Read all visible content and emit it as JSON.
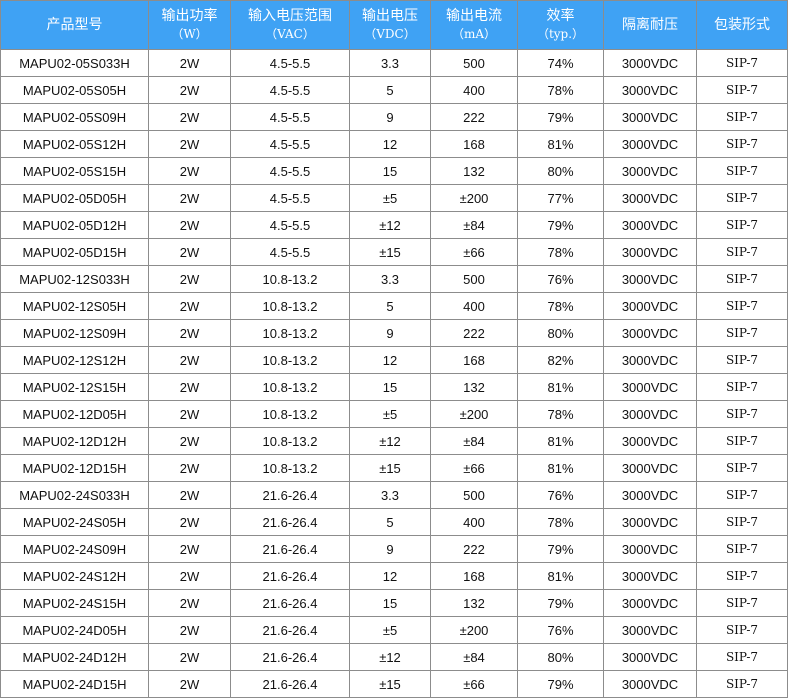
{
  "header": [
    {
      "label": "产品型号",
      "unit": ""
    },
    {
      "label": "输出功率",
      "unit": "（W）"
    },
    {
      "label": "输入电压范围",
      "unit": "（VAC）"
    },
    {
      "label": "输出电压",
      "unit": "（VDC）"
    },
    {
      "label": "输出电流",
      "unit": "（mA）"
    },
    {
      "label": "效率",
      "unit": "（typ.）"
    },
    {
      "label": "隔离耐压",
      "unit": ""
    },
    {
      "label": "包装形式",
      "unit": ""
    }
  ],
  "rows": [
    [
      "MAPU02-05S033H",
      "2W",
      "4.5-5.5",
      "3.3",
      "500",
      "74%",
      "3000VDC",
      "SIP-7"
    ],
    [
      "MAPU02-05S05H",
      "2W",
      "4.5-5.5",
      "5",
      "400",
      "78%",
      "3000VDC",
      "SIP-7"
    ],
    [
      "MAPU02-05S09H",
      "2W",
      "4.5-5.5",
      "9",
      "222",
      "79%",
      "3000VDC",
      "SIP-7"
    ],
    [
      "MAPU02-05S12H",
      "2W",
      "4.5-5.5",
      "12",
      "168",
      "81%",
      "3000VDC",
      "SIP-7"
    ],
    [
      "MAPU02-05S15H",
      "2W",
      "4.5-5.5",
      "15",
      "132",
      "80%",
      "3000VDC",
      "SIP-7"
    ],
    [
      "MAPU02-05D05H",
      "2W",
      "4.5-5.5",
      "±5",
      "±200",
      "77%",
      "3000VDC",
      "SIP-7"
    ],
    [
      "MAPU02-05D12H",
      "2W",
      "4.5-5.5",
      "±12",
      "±84",
      "79%",
      "3000VDC",
      "SIP-7"
    ],
    [
      "MAPU02-05D15H",
      "2W",
      "4.5-5.5",
      "±15",
      "±66",
      "78%",
      "3000VDC",
      "SIP-7"
    ],
    [
      "MAPU02-12S033H",
      "2W",
      "10.8-13.2",
      "3.3",
      "500",
      "76%",
      "3000VDC",
      "SIP-7"
    ],
    [
      "MAPU02-12S05H",
      "2W",
      "10.8-13.2",
      "5",
      "400",
      "78%",
      "3000VDC",
      "SIP-7"
    ],
    [
      "MAPU02-12S09H",
      "2W",
      "10.8-13.2",
      "9",
      "222",
      "80%",
      "3000VDC",
      "SIP-7"
    ],
    [
      "MAPU02-12S12H",
      "2W",
      "10.8-13.2",
      "12",
      "168",
      "82%",
      "3000VDC",
      "SIP-7"
    ],
    [
      "MAPU02-12S15H",
      "2W",
      "10.8-13.2",
      "15",
      "132",
      "81%",
      "3000VDC",
      "SIP-7"
    ],
    [
      "MAPU02-12D05H",
      "2W",
      "10.8-13.2",
      "±5",
      "±200",
      "78%",
      "3000VDC",
      "SIP-7"
    ],
    [
      "MAPU02-12D12H",
      "2W",
      "10.8-13.2",
      "±12",
      "±84",
      "81%",
      "3000VDC",
      "SIP-7"
    ],
    [
      "MAPU02-12D15H",
      "2W",
      "10.8-13.2",
      "±15",
      "±66",
      "81%",
      "3000VDC",
      "SIP-7"
    ],
    [
      "MAPU02-24S033H",
      "2W",
      "21.6-26.4",
      "3.3",
      "500",
      "76%",
      "3000VDC",
      "SIP-7"
    ],
    [
      "MAPU02-24S05H",
      "2W",
      "21.6-26.4",
      "5",
      "400",
      "78%",
      "3000VDC",
      "SIP-7"
    ],
    [
      "MAPU02-24S09H",
      "2W",
      "21.6-26.4",
      "9",
      "222",
      "79%",
      "3000VDC",
      "SIP-7"
    ],
    [
      "MAPU02-24S12H",
      "2W",
      "21.6-26.4",
      "12",
      "168",
      "81%",
      "3000VDC",
      "SIP-7"
    ],
    [
      "MAPU02-24S15H",
      "2W",
      "21.6-26.4",
      "15",
      "132",
      "79%",
      "3000VDC",
      "SIP-7"
    ],
    [
      "MAPU02-24D05H",
      "2W",
      "21.6-26.4",
      "±5",
      "±200",
      "76%",
      "3000VDC",
      "SIP-7"
    ],
    [
      "MAPU02-24D12H",
      "2W",
      "21.6-26.4",
      "±12",
      "±84",
      "80%",
      "3000VDC",
      "SIP-7"
    ],
    [
      "MAPU02-24D15H",
      "2W",
      "21.6-26.4",
      "±15",
      "±66",
      "79%",
      "3000VDC",
      "SIP-7"
    ]
  ],
  "colors": {
    "header_bg": "#3fa2f4",
    "header_text": "#ffffff",
    "border": "#8c8c8c"
  }
}
